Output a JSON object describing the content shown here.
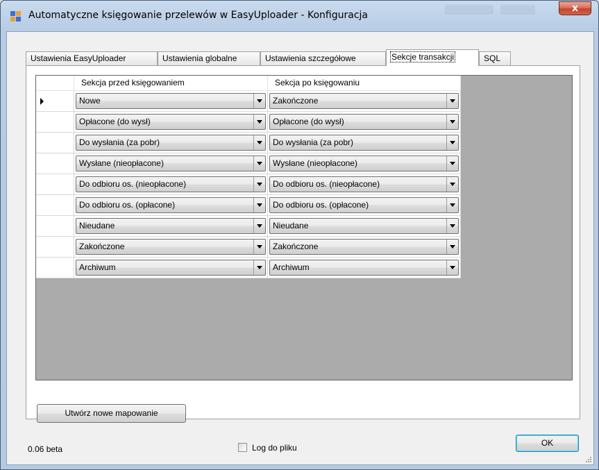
{
  "window": {
    "title": "Automatyczne księgowanie przelewów w EasyUploader - Konfiguracja",
    "close_label": "x"
  },
  "tabs": [
    {
      "label": "Ustawienia EasyUploader",
      "active": false
    },
    {
      "label": "Ustawienia globalne",
      "active": false
    },
    {
      "label": "Ustawienia szczegółowe",
      "active": false
    },
    {
      "label": "Sekcje transakcji",
      "active": true
    },
    {
      "label": "SQL",
      "active": false
    }
  ],
  "grid": {
    "columns": [
      "Sekcja przed księgowaniem",
      "Sekcja po księgowaniu"
    ],
    "current_row": 0,
    "rows": [
      {
        "before": "Nowe",
        "after": "Zakończone"
      },
      {
        "before": "Opłacone (do wysł)",
        "after": "Opłacone (do wysł)"
      },
      {
        "before": "Do wysłania (za pobr)",
        "after": "Do wysłania (za pobr)"
      },
      {
        "before": "Wysłane (nieopłacone)",
        "after": "Wysłane (nieopłacone)"
      },
      {
        "before": "Do odbioru os. (nieopłacone)",
        "after": "Do odbioru os. (nieopłacone)"
      },
      {
        "before": "Do odbioru os. (opłacone)",
        "after": "Do odbioru os. (opłacone)"
      },
      {
        "before": "Nieudane",
        "after": "Nieudane"
      },
      {
        "before": "Zakończone",
        "after": "Zakończone"
      },
      {
        "before": "Archiwum",
        "after": "Archiwum"
      }
    ]
  },
  "buttons": {
    "new_mapping": "Utwórz nowe mapowanie",
    "ok": "OK"
  },
  "footer": {
    "version": "0.06 beta",
    "log_checkbox_label": "Log do pliku",
    "log_checked": false
  },
  "colors": {
    "grid_background": "#ababab",
    "titlebar": "#bcd0e7",
    "close_button": "#c5432b"
  }
}
